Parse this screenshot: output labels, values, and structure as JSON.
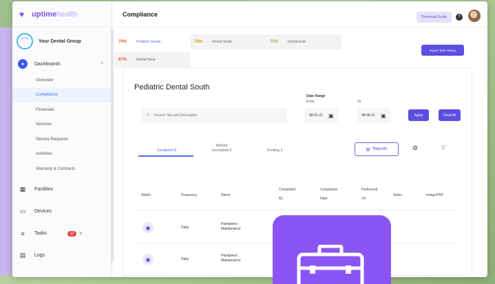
{
  "brand": {
    "name_bold": "uptime",
    "name_light": "health"
  },
  "group": {
    "name": "Your Dental Group"
  },
  "sidebar": {
    "dashboards": "Dashboards",
    "sub_items": [
      "Overview",
      "Compliance",
      "Financials",
      "Services",
      "Service Requests",
      "Activities",
      "Warranty & Contracts"
    ],
    "facilities": "Facilities",
    "devices": "Devices",
    "tasks": "Tasks",
    "tasks_badge": "12",
    "logs": "Logs"
  },
  "header": {
    "title": "Compliance",
    "download_label": "Download Guide"
  },
  "locations": [
    {
      "pct": "70%",
      "name": "Pediatric Dental...",
      "pct_color": "#e05a1a",
      "bg": "#ffffff",
      "name_color": "#4a6cf0"
    },
    {
      "pct": "78%",
      "name": "Dental South",
      "pct_color": "#c6a11a",
      "bg": "#f3f3f6",
      "name_color": "#666666"
    },
    {
      "pct": "71%",
      "name": "Dental East",
      "pct_color": "#c6a11a",
      "bg": "#f3f3f6",
      "name_color": "#666666"
    },
    {
      "pct": "67%",
      "name": "Dental West",
      "pct_color": "#e05a1a",
      "bg": "#f3f3f6",
      "name_color": "#666666"
    }
  ],
  "export_label": "Export Task History",
  "panel": {
    "title": "Pediatric Dental South",
    "date_range": "Date Range",
    "from": "From",
    "to": "To",
    "search_placeholder": "Search Title and Description",
    "from_date": "08-01-21",
    "to_date": "08-08-21",
    "apply": "Apply",
    "clear": "Clear All"
  },
  "status_tabs": {
    "completed": "Completed 8",
    "marked_incomplete_1": "Marked",
    "marked_incomplete_2": "Incomplete 0",
    "pending": "Pending 3"
  },
  "reports_label": "Reports",
  "table": {
    "headers": {
      "watch": "Watch",
      "frequency": "Frequency",
      "name": "Name",
      "completed_by_1": "Completed",
      "completed_by_2": "By",
      "completion_date_1": "Completion",
      "completion_date_2": "Date",
      "performed_on_1": "Performed",
      "performed_on_2": "On",
      "notes": "Notes",
      "image_pdf": "Image/PDF"
    },
    "rows": [
      {
        "frequency": "Daily",
        "name_1": "Handpiece",
        "name_2": "Maintenance",
        "image": "--"
      },
      {
        "frequency": "Daily",
        "name_1": "Handpiece",
        "name_2": "Maintenance",
        "image": "--"
      }
    ]
  },
  "colors": {
    "accent": "#5b4ee0",
    "overlay": "#8b55f5",
    "lavender": "#c9b5f0"
  }
}
